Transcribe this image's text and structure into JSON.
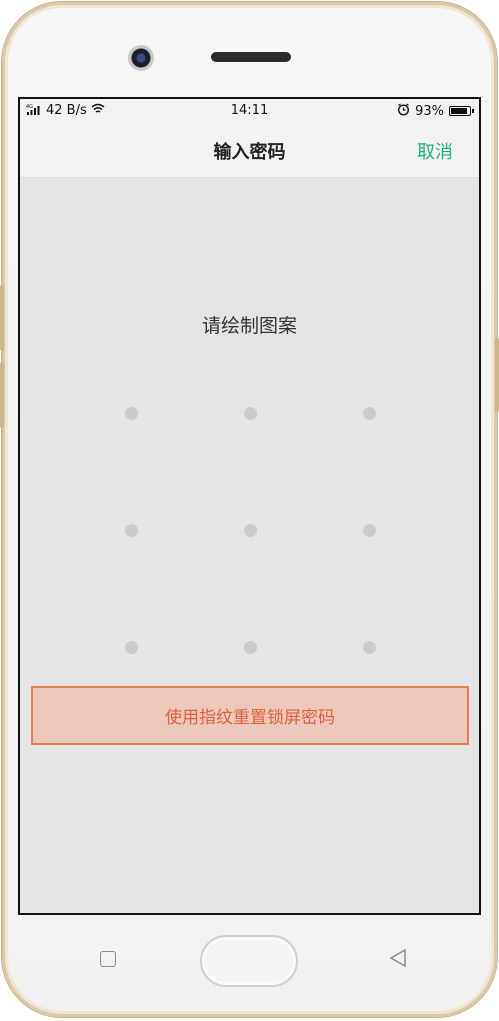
{
  "status_bar": {
    "network_type": "4G",
    "speed": "42 B/s",
    "time": "14:11",
    "battery_percent": "93%",
    "battery_level": 0.93,
    "icons": [
      "signal-icon",
      "wifi-icon",
      "alarm-icon",
      "battery-icon"
    ]
  },
  "header": {
    "title": "输入密码",
    "cancel_label": "取消"
  },
  "pattern": {
    "prompt": "请绘制图案",
    "grid_size": 9,
    "dot_color": "#cbcbcb"
  },
  "reset_button": {
    "label": "使用指纹重置锁屏密码"
  },
  "colors": {
    "accent": "#1db27a",
    "reset_bg": "#ecc9bb",
    "reset_border": "#ee7a52",
    "reset_text": "#e45f3b"
  },
  "device_keys": [
    "recent-apps-key",
    "home-key",
    "back-key"
  ]
}
